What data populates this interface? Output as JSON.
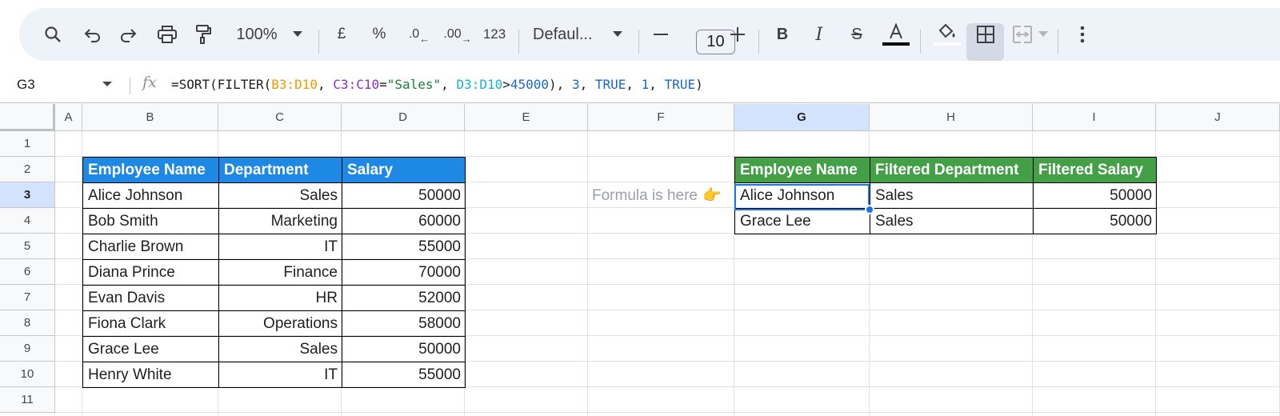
{
  "toolbar": {
    "zoom": "100%",
    "currency": "£",
    "percent": "%",
    "decrease_decimal": ".0",
    "increase_decimal": ".00",
    "number_format": "123",
    "font": "Defaul...",
    "font_size": "10",
    "icons": [
      "search-icon",
      "undo-icon",
      "redo-icon",
      "print-icon",
      "paint-format-icon",
      "dropdown-icon",
      "minus-icon",
      "plus-icon",
      "bold-icon",
      "italic-icon",
      "strikethrough-icon",
      "text-color-icon",
      "fill-color-icon",
      "borders-icon",
      "merge-icon",
      "more-icon"
    ]
  },
  "formula_bar": {
    "cell_ref": "G3",
    "fx": "fx",
    "formula_parts": [
      {
        "text": "=SORT(FILTER(",
        "color": "#1f1f1f"
      },
      {
        "text": "B3:D10",
        "color": "#f29900"
      },
      {
        "text": ", ",
        "color": "#1f1f1f"
      },
      {
        "text": "C3:C10",
        "color": "#8430ce"
      },
      {
        "text": "=",
        "color": "#1f1f1f"
      },
      {
        "text": "\"Sales\"",
        "color": "#188038"
      },
      {
        "text": ", ",
        "color": "#1f1f1f"
      },
      {
        "text": "D3:D10",
        "color": "#12b5cb"
      },
      {
        "text": ">",
        "color": "#1f1f1f"
      },
      {
        "text": "45000",
        "color": "#1967d2"
      },
      {
        "text": "), ",
        "color": "#1f1f1f"
      },
      {
        "text": "3",
        "color": "#1967d2"
      },
      {
        "text": ", ",
        "color": "#1f1f1f"
      },
      {
        "text": "TRUE",
        "color": "#1967d2"
      },
      {
        "text": ", ",
        "color": "#1f1f1f"
      },
      {
        "text": "1",
        "color": "#1967d2"
      },
      {
        "text": ", ",
        "color": "#1f1f1f"
      },
      {
        "text": "TRUE",
        "color": "#1967d2"
      },
      {
        "text": ")",
        "color": "#1f1f1f"
      }
    ]
  },
  "columns": [
    "A",
    "B",
    "C",
    "D",
    "E",
    "F",
    "G",
    "H",
    "I",
    "J"
  ],
  "rows": [
    "1",
    "2",
    "3",
    "4",
    "5",
    "6",
    "7",
    "8",
    "9",
    "10",
    "11"
  ],
  "selected_column": "G",
  "selected_row": "3",
  "source_table": {
    "headers": [
      "Employee Name",
      "Department",
      "Salary"
    ],
    "rows": [
      [
        "Alice Johnson",
        "Sales",
        "50000"
      ],
      [
        "Bob Smith",
        "Marketing",
        "60000"
      ],
      [
        "Charlie Brown",
        "IT",
        "55000"
      ],
      [
        "Diana Prince",
        "Finance",
        "70000"
      ],
      [
        "Evan Davis",
        "HR",
        "52000"
      ],
      [
        "Fiona Clark",
        "Operations",
        "58000"
      ],
      [
        "Grace Lee",
        "Sales",
        "50000"
      ],
      [
        "Henry White",
        "IT",
        "55000"
      ]
    ]
  },
  "result_table": {
    "headers": [
      "Employee Name",
      "Filtered Department",
      "Filtered Salary"
    ],
    "rows": [
      [
        "Alice Johnson",
        "Sales",
        "50000"
      ],
      [
        "Grace Lee",
        "Sales",
        "50000"
      ]
    ]
  },
  "note": "Formula is here",
  "note_emoji": "👉",
  "colors": {
    "header_blue": "#1e88e5",
    "header_green": "#43a047",
    "selection": "#1a73e8"
  }
}
